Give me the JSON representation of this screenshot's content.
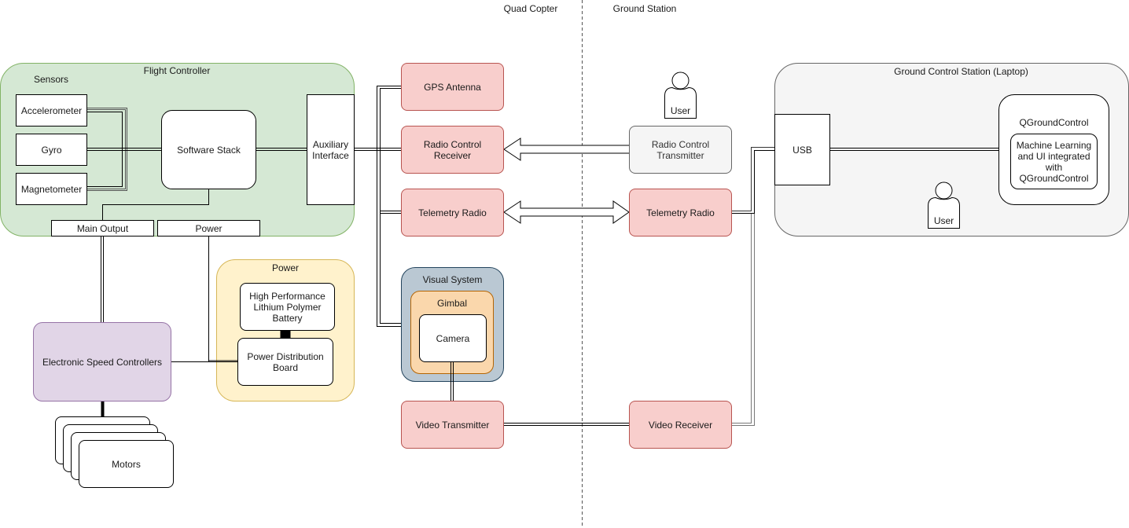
{
  "diagram": {
    "section_labels": {
      "left": "Quad Copter",
      "right": "Ground Station"
    },
    "flight_controller": {
      "title": "Flight Controller",
      "sensors_label": "Sensors",
      "sensors": [
        "Accelerometer",
        "Gyro",
        "Magnetometer"
      ],
      "software_stack": "Software Stack",
      "auxiliary_interface": "Auxiliary Interface",
      "ports": {
        "main_output": "Main Output",
        "power": "Power"
      }
    },
    "power_group": {
      "title": "Power",
      "battery": "High Performance Lithium Polymer Battery",
      "distribution_board": "Power Distribution Board"
    },
    "esc": "Electronic Speed Controllers",
    "motors": "Motors",
    "peripherals": {
      "gps_antenna": "GPS Antenna",
      "rc_receiver": "Radio Control Receiver",
      "telemetry_radio_air": "Telemetry Radio",
      "visual_system": {
        "title": "Visual System",
        "gimbal": "Gimbal",
        "camera": "Camera"
      },
      "video_transmitter": "Video Transmitter"
    },
    "ground": {
      "rc_transmitter": "Radio Control Transmitter",
      "telemetry_radio_ground": "Telemetry Radio",
      "video_receiver": "Video Receiver",
      "user_label": "User",
      "gcs": {
        "title": "Ground Control Station (Laptop)",
        "usb": "USB",
        "qgc_title": "QGroundControl",
        "qgc_inner": "Machine Learning and UI integrated with QGroundControl",
        "user_label": "User"
      }
    },
    "colors": {
      "flight_controller_fill": "#d5e8d4",
      "flight_controller_stroke": "#82b366",
      "power_fill": "#fff2cc",
      "power_stroke": "#d6b656",
      "esc_fill": "#e1d5e7",
      "esc_stroke": "#9673a6",
      "radio_fill": "#f8cecc",
      "radio_stroke": "#b85450",
      "visual_fill": "#bac8d3",
      "visual_stroke": "#23445d",
      "gimbal_fill": "#fad7ac",
      "gimbal_stroke": "#b46504",
      "gcs_fill": "#f5f5f5",
      "gcs_stroke": "#666666"
    }
  }
}
